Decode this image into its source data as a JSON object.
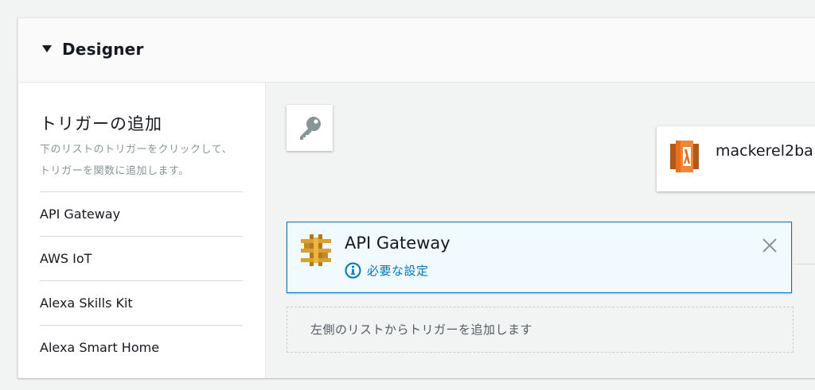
{
  "designer": {
    "title": "Designer",
    "sidebar": {
      "title": "トリガーの追加",
      "description": "下のリストのトリガーをクリックして、トリガーを関数に追加します。",
      "triggers": [
        {
          "label": "API Gateway"
        },
        {
          "label": "AWS IoT"
        },
        {
          "label": "Alexa Skills Kit"
        },
        {
          "label": "Alexa Smart Home"
        }
      ]
    },
    "canvas": {
      "layers_icon": "key-icon",
      "function": {
        "name": "mackerel2ba",
        "icon": "lambda-icon",
        "icon_color": "#e7701c"
      },
      "trigger_card": {
        "name": "API Gateway",
        "icon": "api-gateway-icon",
        "icon_color": "#d9a033",
        "config_warning": "必要な設定",
        "border_color": "#0073bb"
      },
      "drop_zone_text": "左側のリストからトリガーを追加します"
    }
  }
}
